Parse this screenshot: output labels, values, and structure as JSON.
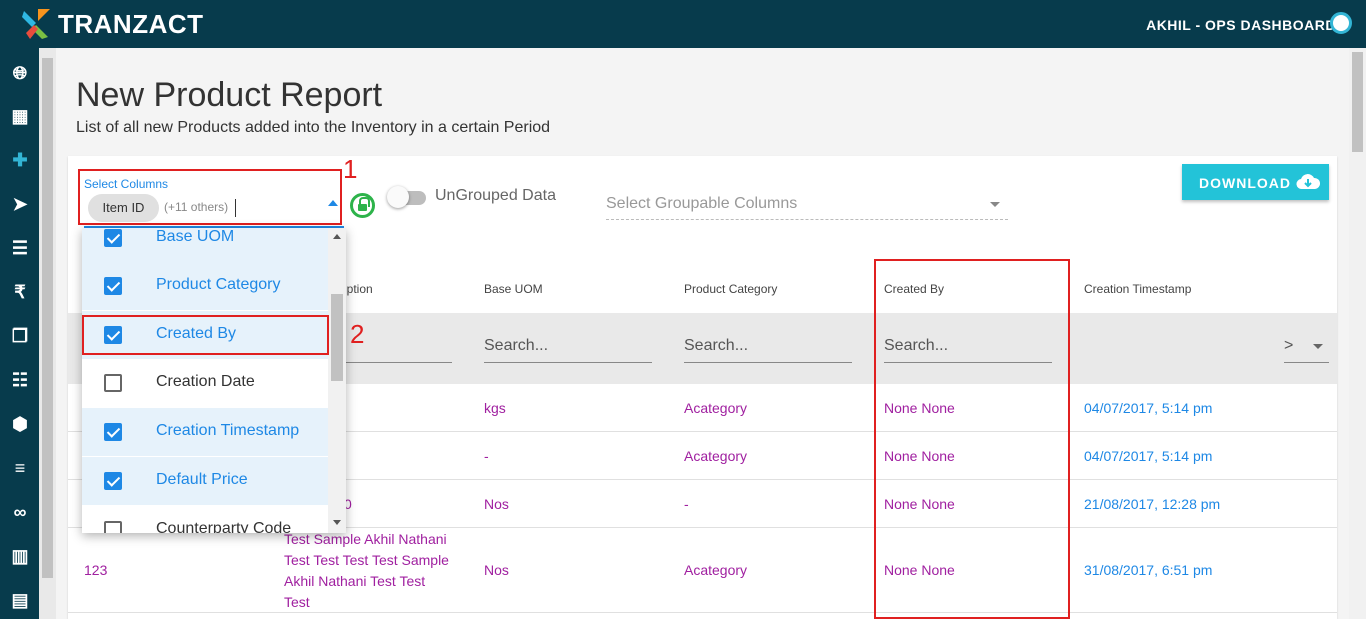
{
  "header": {
    "brand": "TRANZACT",
    "user": "AKHIL - OPS DASHBOARD"
  },
  "sidebar": {
    "icons": [
      "globe-icon",
      "building-icon",
      "plus-icon",
      "send-icon",
      "list-icon",
      "rupee-icon",
      "copy-icon",
      "document-icon",
      "box-icon",
      "truck-icon",
      "link-icon",
      "book-icon",
      "notebook-icon"
    ]
  },
  "page": {
    "title": "New Product Report",
    "subtitle": "List of all new Products added into the Inventory in a certain Period"
  },
  "column_select": {
    "label": "Select Columns",
    "chip": "Item ID",
    "others": "(+11 others)",
    "options": [
      {
        "label": "Base UOM",
        "checked": true
      },
      {
        "label": "Product Category",
        "checked": true
      },
      {
        "label": "Created By",
        "checked": true
      },
      {
        "label": "Creation Date",
        "checked": false
      },
      {
        "label": "Creation Timestamp",
        "checked": true
      },
      {
        "label": "Default Price",
        "checked": true
      },
      {
        "label": "Counterparty Code",
        "checked": false
      }
    ]
  },
  "annotations": {
    "one": "1",
    "two": "2"
  },
  "toggle": {
    "label": "UnGrouped Data",
    "on": false
  },
  "group_select": {
    "placeholder": "Select Groupable Columns"
  },
  "download": {
    "label": "DOWNLOAD"
  },
  "table": {
    "headers": {
      "description": "ription",
      "base_uom": "Base UOM",
      "category": "Product Category",
      "created_by": "Created By",
      "timestamp": "Creation Timestamp"
    },
    "search_placeholder": "Search...",
    "more_select": ">",
    "rows": [
      {
        "id": "",
        "description": "",
        "uom": "kgs",
        "category": "Acategory",
        "created_by": "None None",
        "timestamp": "04/07/2017, 5:14 pm"
      },
      {
        "id": "",
        "description": "",
        "uom": "-",
        "category": "Acategory",
        "created_by": "None None",
        "timestamp": "04/07/2017, 5:14 pm"
      },
      {
        "id": "",
        "description": "0",
        "uom": "Nos",
        "category": "-",
        "created_by": "None None",
        "timestamp": "21/08/2017, 12:28 pm"
      },
      {
        "id": "123",
        "description": "Test Sample Akhil Nathani Test Test Test Test Sample Akhil Nathani Test Test Test",
        "uom": "Nos",
        "category": "Acategory",
        "created_by": "None None",
        "timestamp": "31/08/2017, 6:51 pm"
      }
    ]
  },
  "colors": {
    "header_bg": "#073b4c",
    "accent": "#1e88e5",
    "download_bg": "#23c3d8",
    "cell_text": "#a020a0",
    "annotation": "#e02020",
    "toggle_lock": "#2db34a"
  }
}
